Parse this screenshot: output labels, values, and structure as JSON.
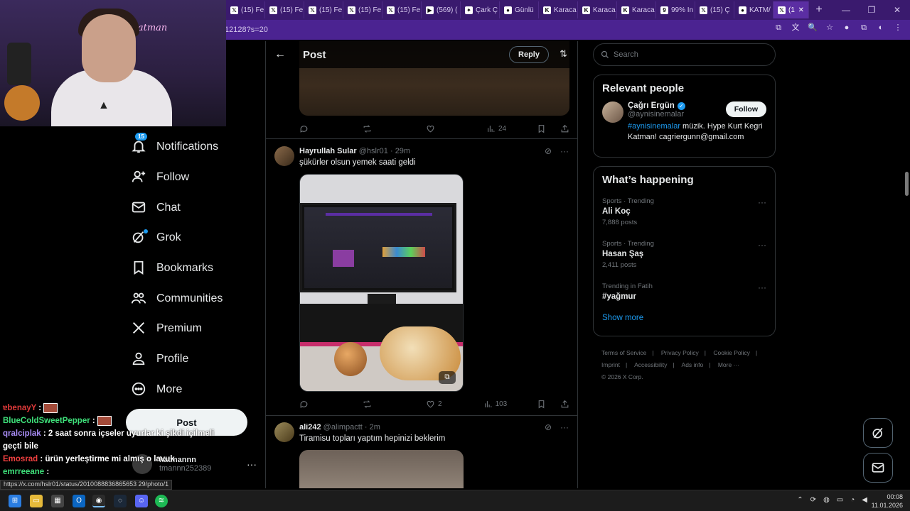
{
  "browser": {
    "tabs": [
      {
        "label": "(15) Fe",
        "icon": "x-icon",
        "icon_glyph": "𝕏"
      },
      {
        "label": "(15) Fe",
        "icon": "x-icon",
        "icon_glyph": "𝕏"
      },
      {
        "label": "(15) Fe",
        "icon": "x-icon",
        "icon_glyph": "𝕏"
      },
      {
        "label": "(15) Fe",
        "icon": "x-icon",
        "icon_glyph": "𝕏"
      },
      {
        "label": "(15) Fe",
        "icon": "x-icon",
        "icon_glyph": "𝕏"
      },
      {
        "label": "(569) (",
        "icon": "youtube-icon",
        "icon_glyph": "▶"
      },
      {
        "label": "Çark Ç",
        "icon": "wheel-icon",
        "icon_glyph": "✦"
      },
      {
        "label": "Günlü",
        "icon": "tab-icon",
        "icon_glyph": "●"
      },
      {
        "label": "Karaca",
        "icon": "tab-icon",
        "icon_glyph": "K"
      },
      {
        "label": "Karaca",
        "icon": "tab-icon",
        "icon_glyph": "K"
      },
      {
        "label": "Karaca",
        "icon": "tab-icon",
        "icon_glyph": "K"
      },
      {
        "label": "99% In",
        "icon": "tab-icon",
        "icon_glyph": "9"
      },
      {
        "label": "(15) Ç",
        "icon": "x-icon",
        "icon_glyph": "𝕏"
      },
      {
        "label": "KATM/",
        "icon": "reddit-icon",
        "icon_glyph": "●"
      }
    ],
    "active_tab": {
      "label": "(1",
      "icon_glyph": "𝕏",
      "close": "✕"
    },
    "new_tab": "+",
    "window_controls": [
      "—",
      "❐",
      "✕"
    ],
    "url": "12128?s=20",
    "address_icons": [
      "⧉",
      "文",
      "🔍",
      "☆",
      "●",
      "⧉",
      "◐",
      "⋮"
    ]
  },
  "webcam": {
    "neon_text": "katman"
  },
  "sidebar": {
    "items": [
      {
        "label": "Notifications",
        "badge": "15"
      },
      {
        "label": "Follow"
      },
      {
        "label": "Chat"
      },
      {
        "label": "Grok"
      },
      {
        "label": "Bookmarks"
      },
      {
        "label": "Communities"
      },
      {
        "label": "Premium"
      },
      {
        "label": "Profile"
      },
      {
        "label": "More"
      }
    ],
    "post_button": "Post",
    "account": {
      "name": "katmannn",
      "handle": "tmannn252389",
      "more": "···"
    }
  },
  "chat": [
    {
      "user": "ɐbenayY",
      "text": " : "
    },
    {
      "user": "BlueColdSweetPepper",
      "text": " : "
    },
    {
      "user": "qralciplak",
      "text": " : 2 saat sonra içseler uyurlar ki şikdi içilmeli geçti bile"
    },
    {
      "user": "Emosrad",
      "text": " : ürün yerleştirme mi almış o lavuk"
    },
    {
      "user": "emrreeane",
      "text": " : "
    }
  ],
  "status_url": "https://x.com/hslr01/status/2010088836865653 29/photo/1",
  "main": {
    "header": {
      "title": "Post",
      "reply_label": "Reply",
      "back": "←",
      "adjust": "⇅"
    },
    "tweet1_stats": {
      "replies": "",
      "retweets": "",
      "likes": "",
      "views": "24"
    },
    "tweet2": {
      "name": "Hayrullah Sular",
      "handle": "@hslr01",
      "time": "· 29m",
      "text": "şükürler olsun yemek saati geldi",
      "stats": {
        "replies": "",
        "retweets": "",
        "likes": "2",
        "views": "103"
      }
    },
    "tweet3": {
      "name": "ali242",
      "handle": "@alimpactt",
      "time": "· 2m",
      "text": "Tiramisu topları yaptım hepinizi beklerim"
    },
    "more_glyph": "···",
    "grok_glyph": "⊘"
  },
  "right": {
    "search_placeholder": "Search",
    "relevant": {
      "title": "Relevant people",
      "name": "Çağrı Ergün",
      "handle": "@aynisinemalar",
      "follow": "Follow",
      "bio_tag": "#aynisinemalar",
      "bio_text": " müzik. Hype Kurt Kegri Katman! cagriergunn@gmail.com"
    },
    "happening": {
      "title": "What’s happening",
      "trends": [
        {
          "meta": "Sports · Trending",
          "name": "Ali Koç",
          "count": "7,888 posts"
        },
        {
          "meta": "Sports · Trending",
          "name": "Hasan Şaş",
          "count": "2,411 posts"
        },
        {
          "meta": "Trending in Fatih",
          "name": "#yağmur",
          "count": ""
        }
      ],
      "show_more": "Show more"
    },
    "footer": {
      "line1": [
        "Terms of Service",
        "|",
        "Privacy Policy",
        "|",
        "Cookie Policy",
        "|"
      ],
      "line2": [
        "Imprint",
        "|",
        "Accessibility",
        "|",
        "Ads info",
        "|",
        "More ···"
      ],
      "line3": "© 2026 X Corp."
    }
  },
  "taskbar": {
    "time": "00:08",
    "date": "11.01.2026",
    "tray_chevron": "⌃"
  },
  "colors": {
    "accent": "#1d9bf0",
    "browser_frame": "#3a1a6e",
    "background": "#000000"
  }
}
